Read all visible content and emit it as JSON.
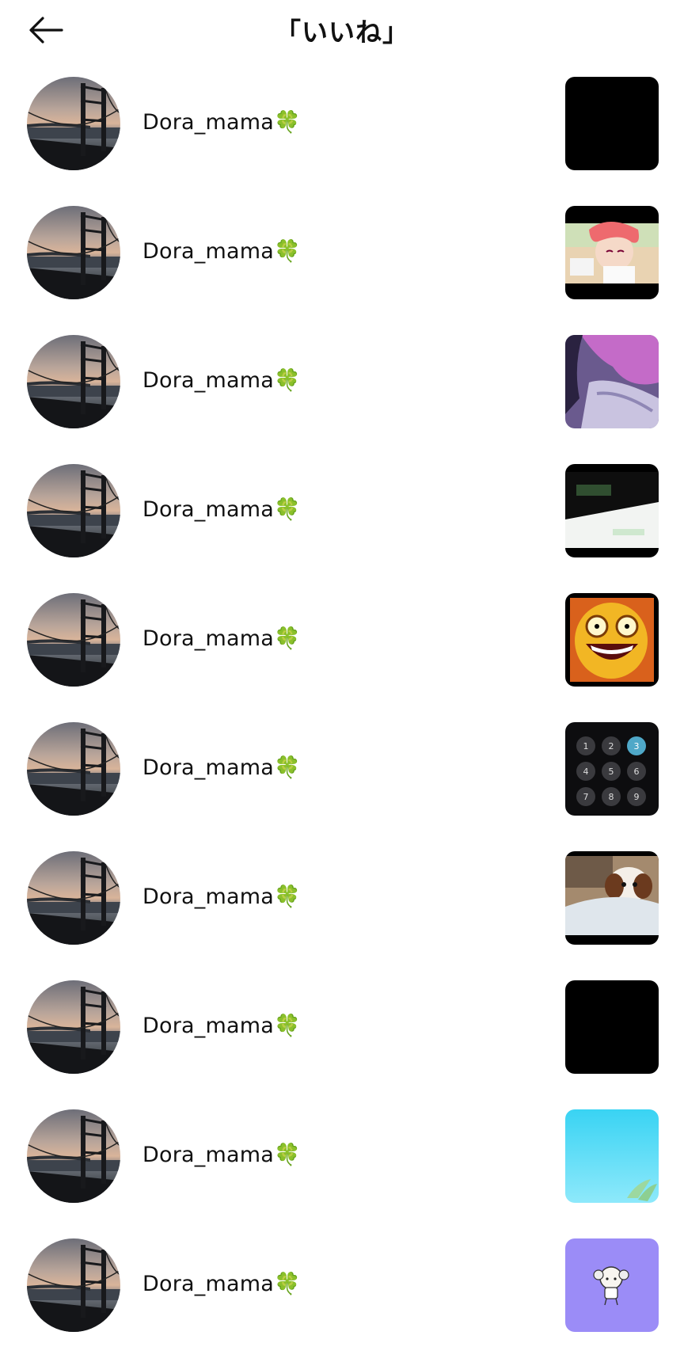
{
  "header": {
    "title": "「いいね」",
    "back_icon": "arrow-left-icon"
  },
  "likes": [
    {
      "username": "Dora_mama🍀",
      "thumbnail": "black"
    },
    {
      "username": "Dora_mama🍀",
      "thumbnail": "anime-pink-hair-girl"
    },
    {
      "username": "Dora_mama🍀",
      "thumbnail": "anime-pink-hair-closeup"
    },
    {
      "username": "Dora_mama🍀",
      "thumbnail": "white-green-diagonal"
    },
    {
      "username": "Dora_mama🍀",
      "thumbnail": "cartoon-face-laughing"
    },
    {
      "username": "Dora_mama🍀",
      "thumbnail": "phone-keypad"
    },
    {
      "username": "Dora_mama🍀",
      "thumbnail": "puppy-photo"
    },
    {
      "username": "Dora_mama🍀",
      "thumbnail": "black"
    },
    {
      "username": "Dora_mama🍀",
      "thumbnail": "light-blue-sky"
    },
    {
      "username": "Dora_mama🍀",
      "thumbnail": "purple-chibi-character"
    }
  ],
  "keypad": [
    "1",
    "2",
    "3",
    "4",
    "5",
    "6",
    "7",
    "8",
    "9"
  ],
  "colors": {
    "background": "#ffffff",
    "text": "#111111",
    "keypad_highlight": "#4fa8c8",
    "purple_thumb": "#9b8cf7",
    "sky_thumb": "#34d6f5"
  }
}
